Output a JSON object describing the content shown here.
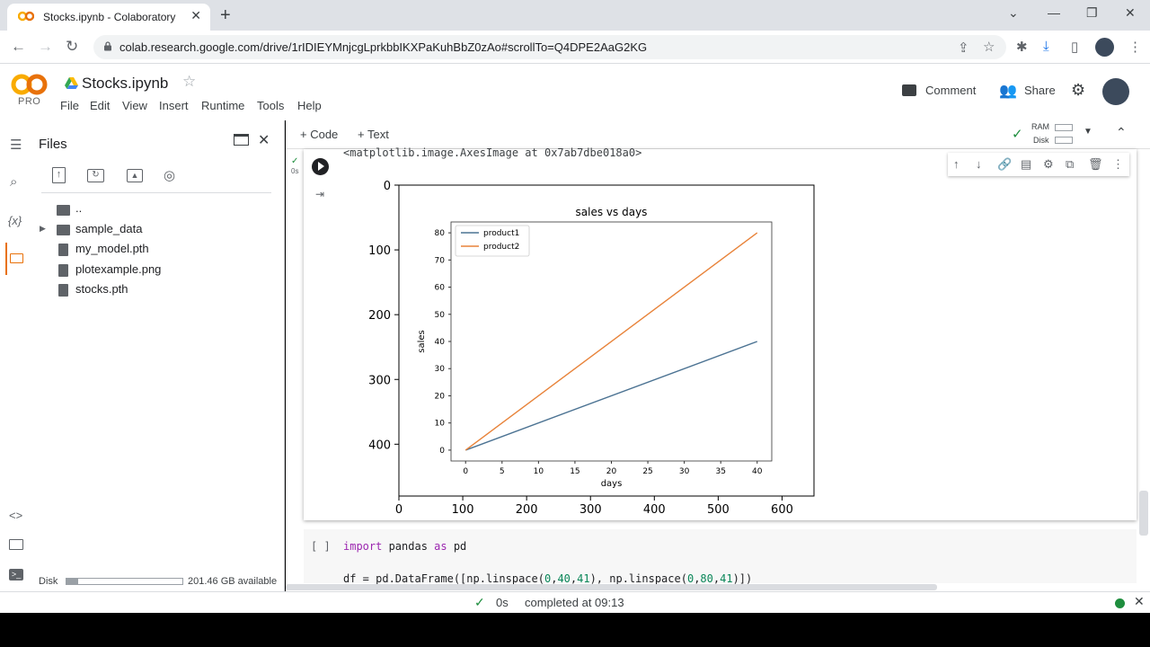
{
  "browser": {
    "tab_title": "Stocks.ipynb - Colaboratory",
    "url": "colab.research.google.com/drive/1rIDIEYMnjcgLprkbbIKXPaKuhBbZ0zAo#scrollTo=Q4DPE2AaG2KG"
  },
  "header": {
    "pro_label": "PRO",
    "notebook_title": "Stocks.ipynb",
    "menu": [
      "File",
      "Edit",
      "View",
      "Insert",
      "Runtime",
      "Tools",
      "Help"
    ],
    "comment_label": "Comment",
    "share_label": "Share"
  },
  "sidebar": {
    "title": "Files",
    "tree": [
      {
        "label": "..",
        "type": "parent"
      },
      {
        "label": "sample_data",
        "type": "folder"
      },
      {
        "label": "my_model.pth",
        "type": "file"
      },
      {
        "label": "plotexample.png",
        "type": "file"
      },
      {
        "label": "stocks.pth",
        "type": "file"
      }
    ],
    "disk_label": "Disk",
    "disk_used_fraction": 0.1,
    "disk_available": "201.46 GB available"
  },
  "main_toolbar": {
    "code_label": "+ Code",
    "text_label": "+ Text",
    "ram_label": "RAM",
    "disk_label": "Disk"
  },
  "cell": {
    "exec_time": "0s",
    "output_text": "<matplotlib.image.AxesImage at 0x7ab7dbe018a0>",
    "code_bracket": "[ ]",
    "code_lines": [
      "import pandas as pd",
      "",
      "df = pd.DataFrame([np.linspace(0,40,41), np.linspace(0,80,41)])"
    ]
  },
  "status": {
    "time": "0s",
    "text": "completed at 09:13"
  },
  "colors": {
    "product1": "#4c7393",
    "product2": "#e8833a",
    "check_green": "#1e8e3e",
    "colab_orange": "#f9ab00"
  },
  "chart_data": [
    {
      "type": "image-axes",
      "xlim": [
        0,
        650
      ],
      "ylim": [
        480,
        0
      ],
      "x_ticks": [
        0,
        100,
        200,
        300,
        400,
        500,
        600
      ],
      "y_ticks": [
        0,
        100,
        200,
        300,
        400
      ]
    },
    {
      "type": "line",
      "title": "sales vs days",
      "xlabel": "days",
      "ylabel": "sales",
      "xlim": [
        -2,
        42
      ],
      "ylim": [
        -4,
        84
      ],
      "x_ticks": [
        0,
        5,
        10,
        15,
        20,
        25,
        30,
        35,
        40
      ],
      "y_ticks": [
        0,
        10,
        20,
        30,
        40,
        50,
        60,
        70,
        80
      ],
      "legend": "top-left",
      "series": [
        {
          "name": "product1",
          "x": [
            0,
            40
          ],
          "y": [
            0,
            40
          ]
        },
        {
          "name": "product2",
          "x": [
            0,
            40
          ],
          "y": [
            0,
            80
          ]
        }
      ]
    }
  ]
}
